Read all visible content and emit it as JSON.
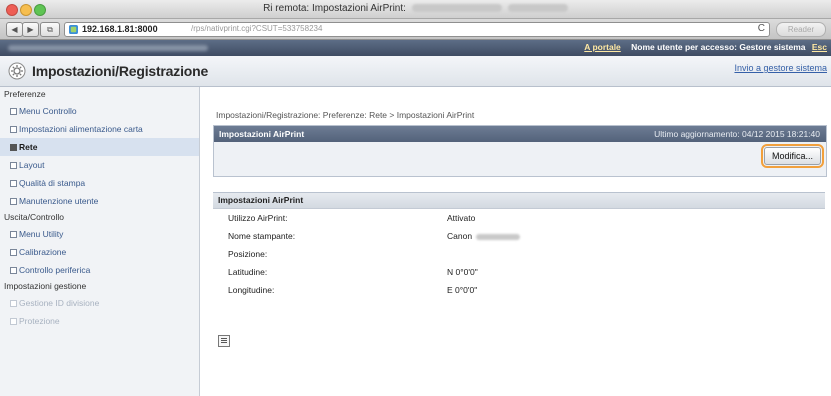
{
  "window": {
    "title": "Ri remota: Impostazioni AirPrint:"
  },
  "browser": {
    "url_host": "192.168.1.81:8000",
    "url_path": "/rps/nativprint.cgi?CSUT=533758234",
    "reader_label": "Reader",
    "reload_icon": "reload-icon"
  },
  "topstrip": {
    "portal_link": "A portale",
    "user_text": "Nome utente per accesso: Gestore sistema",
    "trailing": "Esc"
  },
  "header": {
    "title": "Impostazioni/Registrazione",
    "admin_link": "Invio a gestore sistema"
  },
  "sidebar": {
    "groups": [
      {
        "label": "Preferenze",
        "items": [
          {
            "label": "Menu Controllo"
          },
          {
            "label": "Impostazioni alimentazione carta"
          },
          {
            "label": "Rete"
          },
          {
            "label": "Layout"
          },
          {
            "label": "Qualità di stampa"
          },
          {
            "label": "Manutenzione utente"
          }
        ]
      },
      {
        "label": "Uscita/Controllo",
        "items": [
          {
            "label": "Menu Utility"
          },
          {
            "label": "Calibrazione"
          },
          {
            "label": "Controllo periferica"
          }
        ]
      },
      {
        "label": "Impostazioni gestione",
        "items": [
          {
            "label": "Gestione ID divisione"
          },
          {
            "label": "Protezione"
          }
        ]
      }
    ]
  },
  "main": {
    "breadcrumb": "Impostazioni/Registrazione: Preferenze: Rete > Impostazioni AirPrint",
    "panel1": {
      "title": "Impostazioni AirPrint",
      "last_update": "Ultimo aggiornamento: 04/12 2015 18:21:40",
      "edit_button": "Modifica..."
    },
    "panel2": {
      "title": "Impostazioni AirPrint",
      "rows": [
        {
          "label": "Utilizzo AirPrint:",
          "value": "Attivato"
        },
        {
          "label": "Nome stampante:",
          "value": "Canon"
        },
        {
          "label": "Posizione:",
          "value": ""
        },
        {
          "label": "Latitudine:",
          "value": "N 0°0'0\""
        },
        {
          "label": "Longitudine:",
          "value": "E 0°0'0\""
        }
      ]
    }
  }
}
